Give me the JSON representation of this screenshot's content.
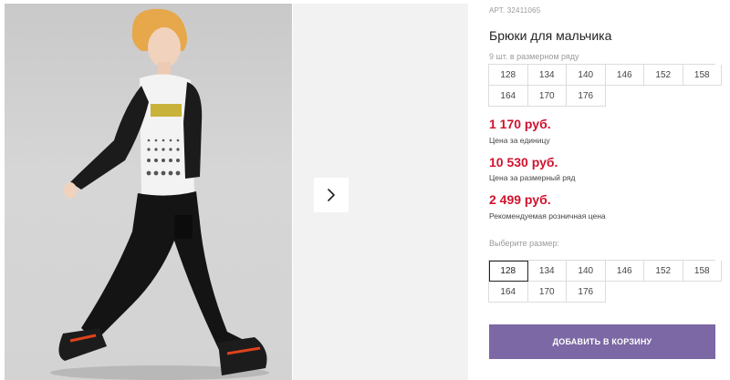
{
  "product": {
    "article": "АРТ. 32411065",
    "title": "Брюки для мальчика"
  },
  "size_range": {
    "label": "9 шт. в размерном ряду",
    "sizes": [
      "128",
      "134",
      "140",
      "146",
      "152",
      "158",
      "164",
      "170",
      "176"
    ]
  },
  "prices": {
    "unit_price": "1 170 руб.",
    "unit_label": "Цена за единицу",
    "range_price": "10 530 руб.",
    "range_label": "Цена за размерный ряд",
    "retail_price": "2 499 руб.",
    "retail_label": "Рекомендуемая розничная цена"
  },
  "size_select": {
    "label": "Выберите размер:",
    "sizes": [
      "128",
      "134",
      "140",
      "146",
      "152",
      "158",
      "164",
      "170",
      "176"
    ],
    "selected": "128"
  },
  "cart_button": {
    "label": "ДОБАВИТЬ В КОРЗИНУ"
  },
  "colors": {
    "accent_button": "#7b68a4",
    "price_red": "#d0132e",
    "photo_background": "#cfcfcf"
  },
  "icons": {
    "gallery_next": "chevron-right-icon"
  }
}
